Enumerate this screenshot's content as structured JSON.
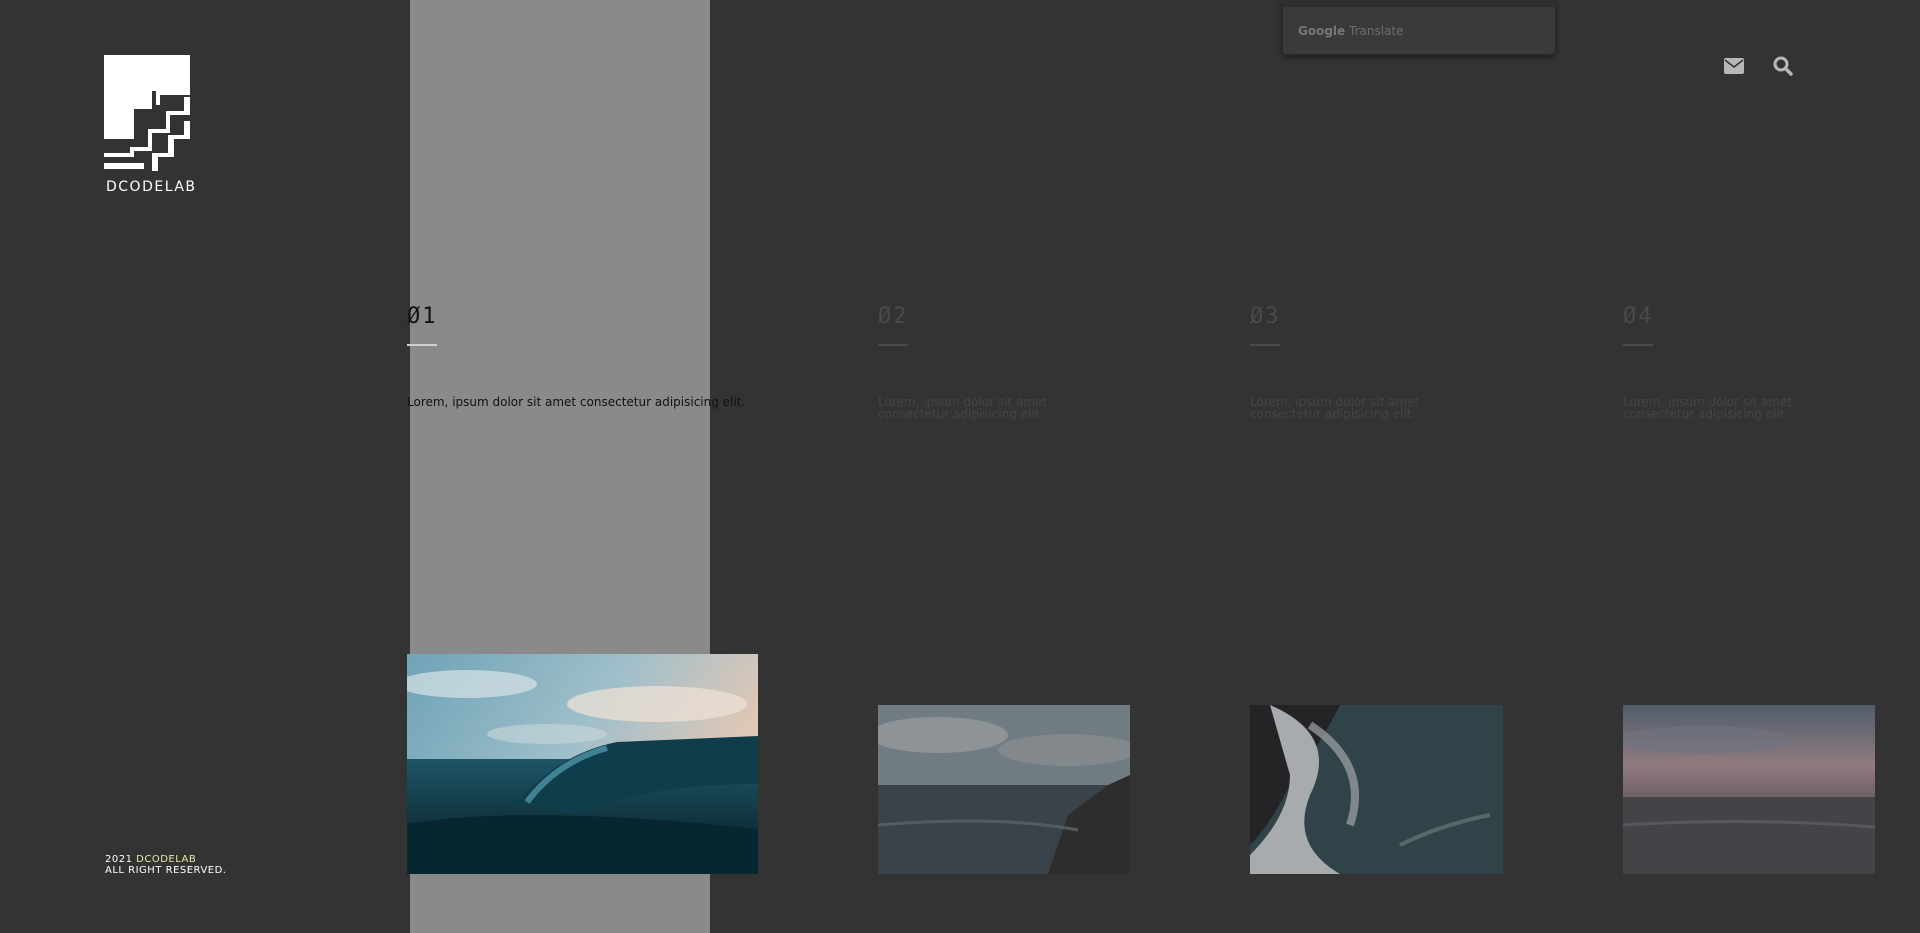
{
  "brand": {
    "name": "DCODELAB"
  },
  "translate": {
    "google": "Google",
    "translate": "Translate"
  },
  "header": {
    "icons": [
      "mail-icon",
      "search-icon"
    ]
  },
  "slides": [
    {
      "number": "Ø1",
      "text": "Lorem, ipsum dolor sit amet consectetur adipisicing elit.",
      "active": true
    },
    {
      "number": "Ø2",
      "text": "Lorem, ipsum dolor sit amet consectetur adipisicing elit.",
      "active": false
    },
    {
      "number": "Ø3",
      "text": "Lorem, ipsum dolor sit amet consectetur adipisicing elit.",
      "active": false
    },
    {
      "number": "Ø4",
      "text": "Lorem, ipsum dolor sit amet consectetur adipisicing elit.",
      "active": false
    }
  ],
  "footer": {
    "year": "2021",
    "brand": "DCODELAB",
    "rights": "ALL RIGHT RESERVED."
  },
  "colors": {
    "background": "#333333",
    "highlight": "#8a8a8a",
    "text": "#ffffff"
  }
}
